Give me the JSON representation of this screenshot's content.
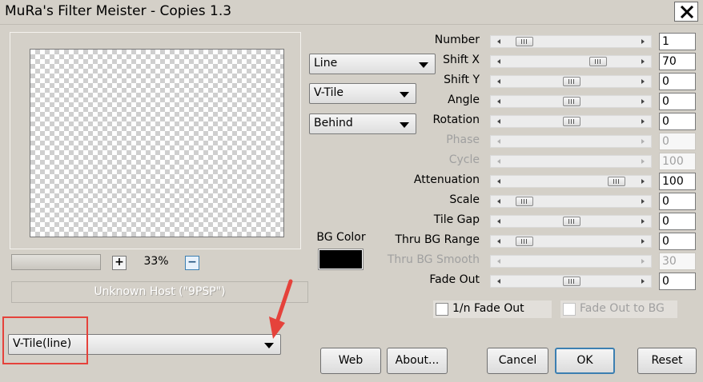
{
  "window": {
    "title": "MuRa's Filter Meister - Copies 1.3"
  },
  "preview": {
    "zoom": "33%",
    "host_text": "Unknown Host (\"9PSP\")"
  },
  "dropdowns": {
    "mode": "Line",
    "tile": "V-Tile",
    "placement": "Behind",
    "preset": "V-Tile(line)"
  },
  "params": [
    {
      "label": "Number",
      "value": "1",
      "fraction": 0.1,
      "enabled": true
    },
    {
      "label": "Shift X",
      "value": "70",
      "fraction": 0.72,
      "enabled": true
    },
    {
      "label": "Shift Y",
      "value": "0",
      "fraction": 0.5,
      "enabled": true
    },
    {
      "label": "Angle",
      "value": "0",
      "fraction": 0.5,
      "enabled": true
    },
    {
      "label": "Rotation",
      "value": "0",
      "fraction": 0.5,
      "enabled": true
    },
    {
      "label": "Phase",
      "value": "0",
      "fraction": 0.0,
      "enabled": false
    },
    {
      "label": "Cycle",
      "value": "100",
      "fraction": 0.0,
      "enabled": false
    },
    {
      "label": "Attenuation",
      "value": "100",
      "fraction": 0.88,
      "enabled": true
    },
    {
      "label": "Scale",
      "value": "0",
      "fraction": 0.1,
      "enabled": true
    },
    {
      "label": "Tile Gap",
      "value": "0",
      "fraction": 0.5,
      "enabled": true
    },
    {
      "label": "Thru BG Range",
      "value": "0",
      "fraction": 0.1,
      "enabled": true
    },
    {
      "label": "Thru BG Smooth",
      "value": "30",
      "fraction": 0.0,
      "enabled": false
    },
    {
      "label": "Fade Out",
      "value": "0",
      "fraction": 0.5,
      "enabled": true
    }
  ],
  "bg_color": {
    "label": "BG Color",
    "color": "#000000"
  },
  "checkboxes": {
    "one_n_fade": {
      "label": "1/n Fade Out",
      "checked": false
    },
    "fade_to_bg": {
      "label": "Fade Out to BG",
      "checked": false
    }
  },
  "buttons": {
    "web": "Web",
    "about": "About...",
    "cancel": "Cancel",
    "ok": "OK",
    "reset": "Reset"
  },
  "colors": {
    "window_bg": "#d4d0c8",
    "highlight_red": "#e5423b",
    "focus_blue": "#3c7fb1"
  },
  "icons": {
    "close": "close-icon",
    "dropdown": "chevron-down-icon",
    "annotation": "arrow-annotation-icon"
  }
}
